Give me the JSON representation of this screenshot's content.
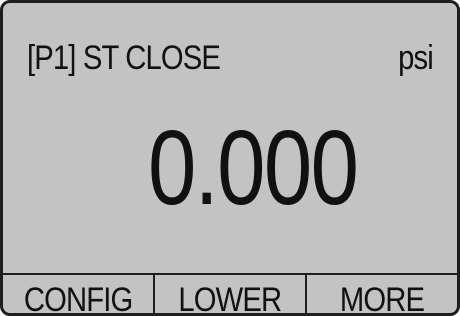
{
  "colors": {
    "screen_background": "#c3c3c3",
    "text": "#111111",
    "border": "#1e1e1e"
  },
  "status": {
    "port_label": "[P1] ST CLOSE",
    "unit": "psi"
  },
  "reading": {
    "value": "0.000"
  },
  "softkeys": [
    {
      "label": "CONFIG"
    },
    {
      "label": "LOWER"
    },
    {
      "label": "MORE"
    }
  ]
}
